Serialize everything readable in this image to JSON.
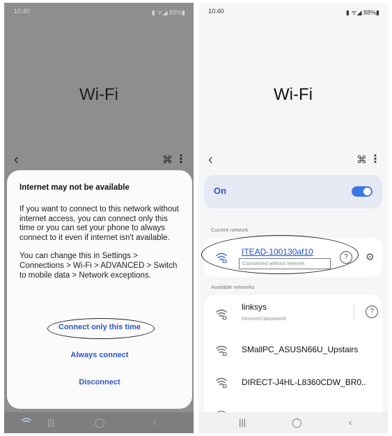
{
  "left": {
    "status": {
      "time": "10:40",
      "icons": "▮ ᯤ◢ 89%▮"
    },
    "title": "Wi-Fi",
    "back_icon": "‹",
    "scan_icon": "⌘",
    "more_icon": "⋮",
    "dialog": {
      "title": "Internet may not be available",
      "para1": "If you want to connect to this network without internet access, you can connect only this time or you can set your phone to always connect to it even if internet isn't available.",
      "para2": "You can change this in Settings > Connections > Wi-Fi > ADVANCED > Switch to mobile data > Network exceptions.",
      "btn_once": "Connect only this time",
      "btn_always": "Always connect",
      "btn_disconnect": "Disconnect"
    },
    "nav": {
      "recent": "|||",
      "home": "◯",
      "back": "‹"
    }
  },
  "right": {
    "status": {
      "time": "10:40",
      "icons": "▮ ᯤ◢ 88%▮"
    },
    "title": "Wi-Fi",
    "back_icon": "‹",
    "scan_icon": "⌘",
    "more_icon": "⋮",
    "on_label": "On",
    "toggle_on": true,
    "current_label": "Current network",
    "current": {
      "name": "ITEAD-100130af10",
      "status": "Connected without internet",
      "help": "?",
      "gear": "⚙"
    },
    "available_label": "Available networks",
    "networks": [
      {
        "name": "linksys",
        "sub": "Incorrect password",
        "help": "?"
      },
      {
        "name": "SMallPC_ASUSN66U_Upstairs"
      },
      {
        "name": "DIRECT-J4HL-L8360CDW_BR0.."
      }
    ],
    "nav": {
      "recent": "|||",
      "home": "◯",
      "back": "‹"
    },
    "colors": {
      "accent": "#2d55c2",
      "toggle": "#3b78e7",
      "link": "#2a56c6"
    }
  }
}
